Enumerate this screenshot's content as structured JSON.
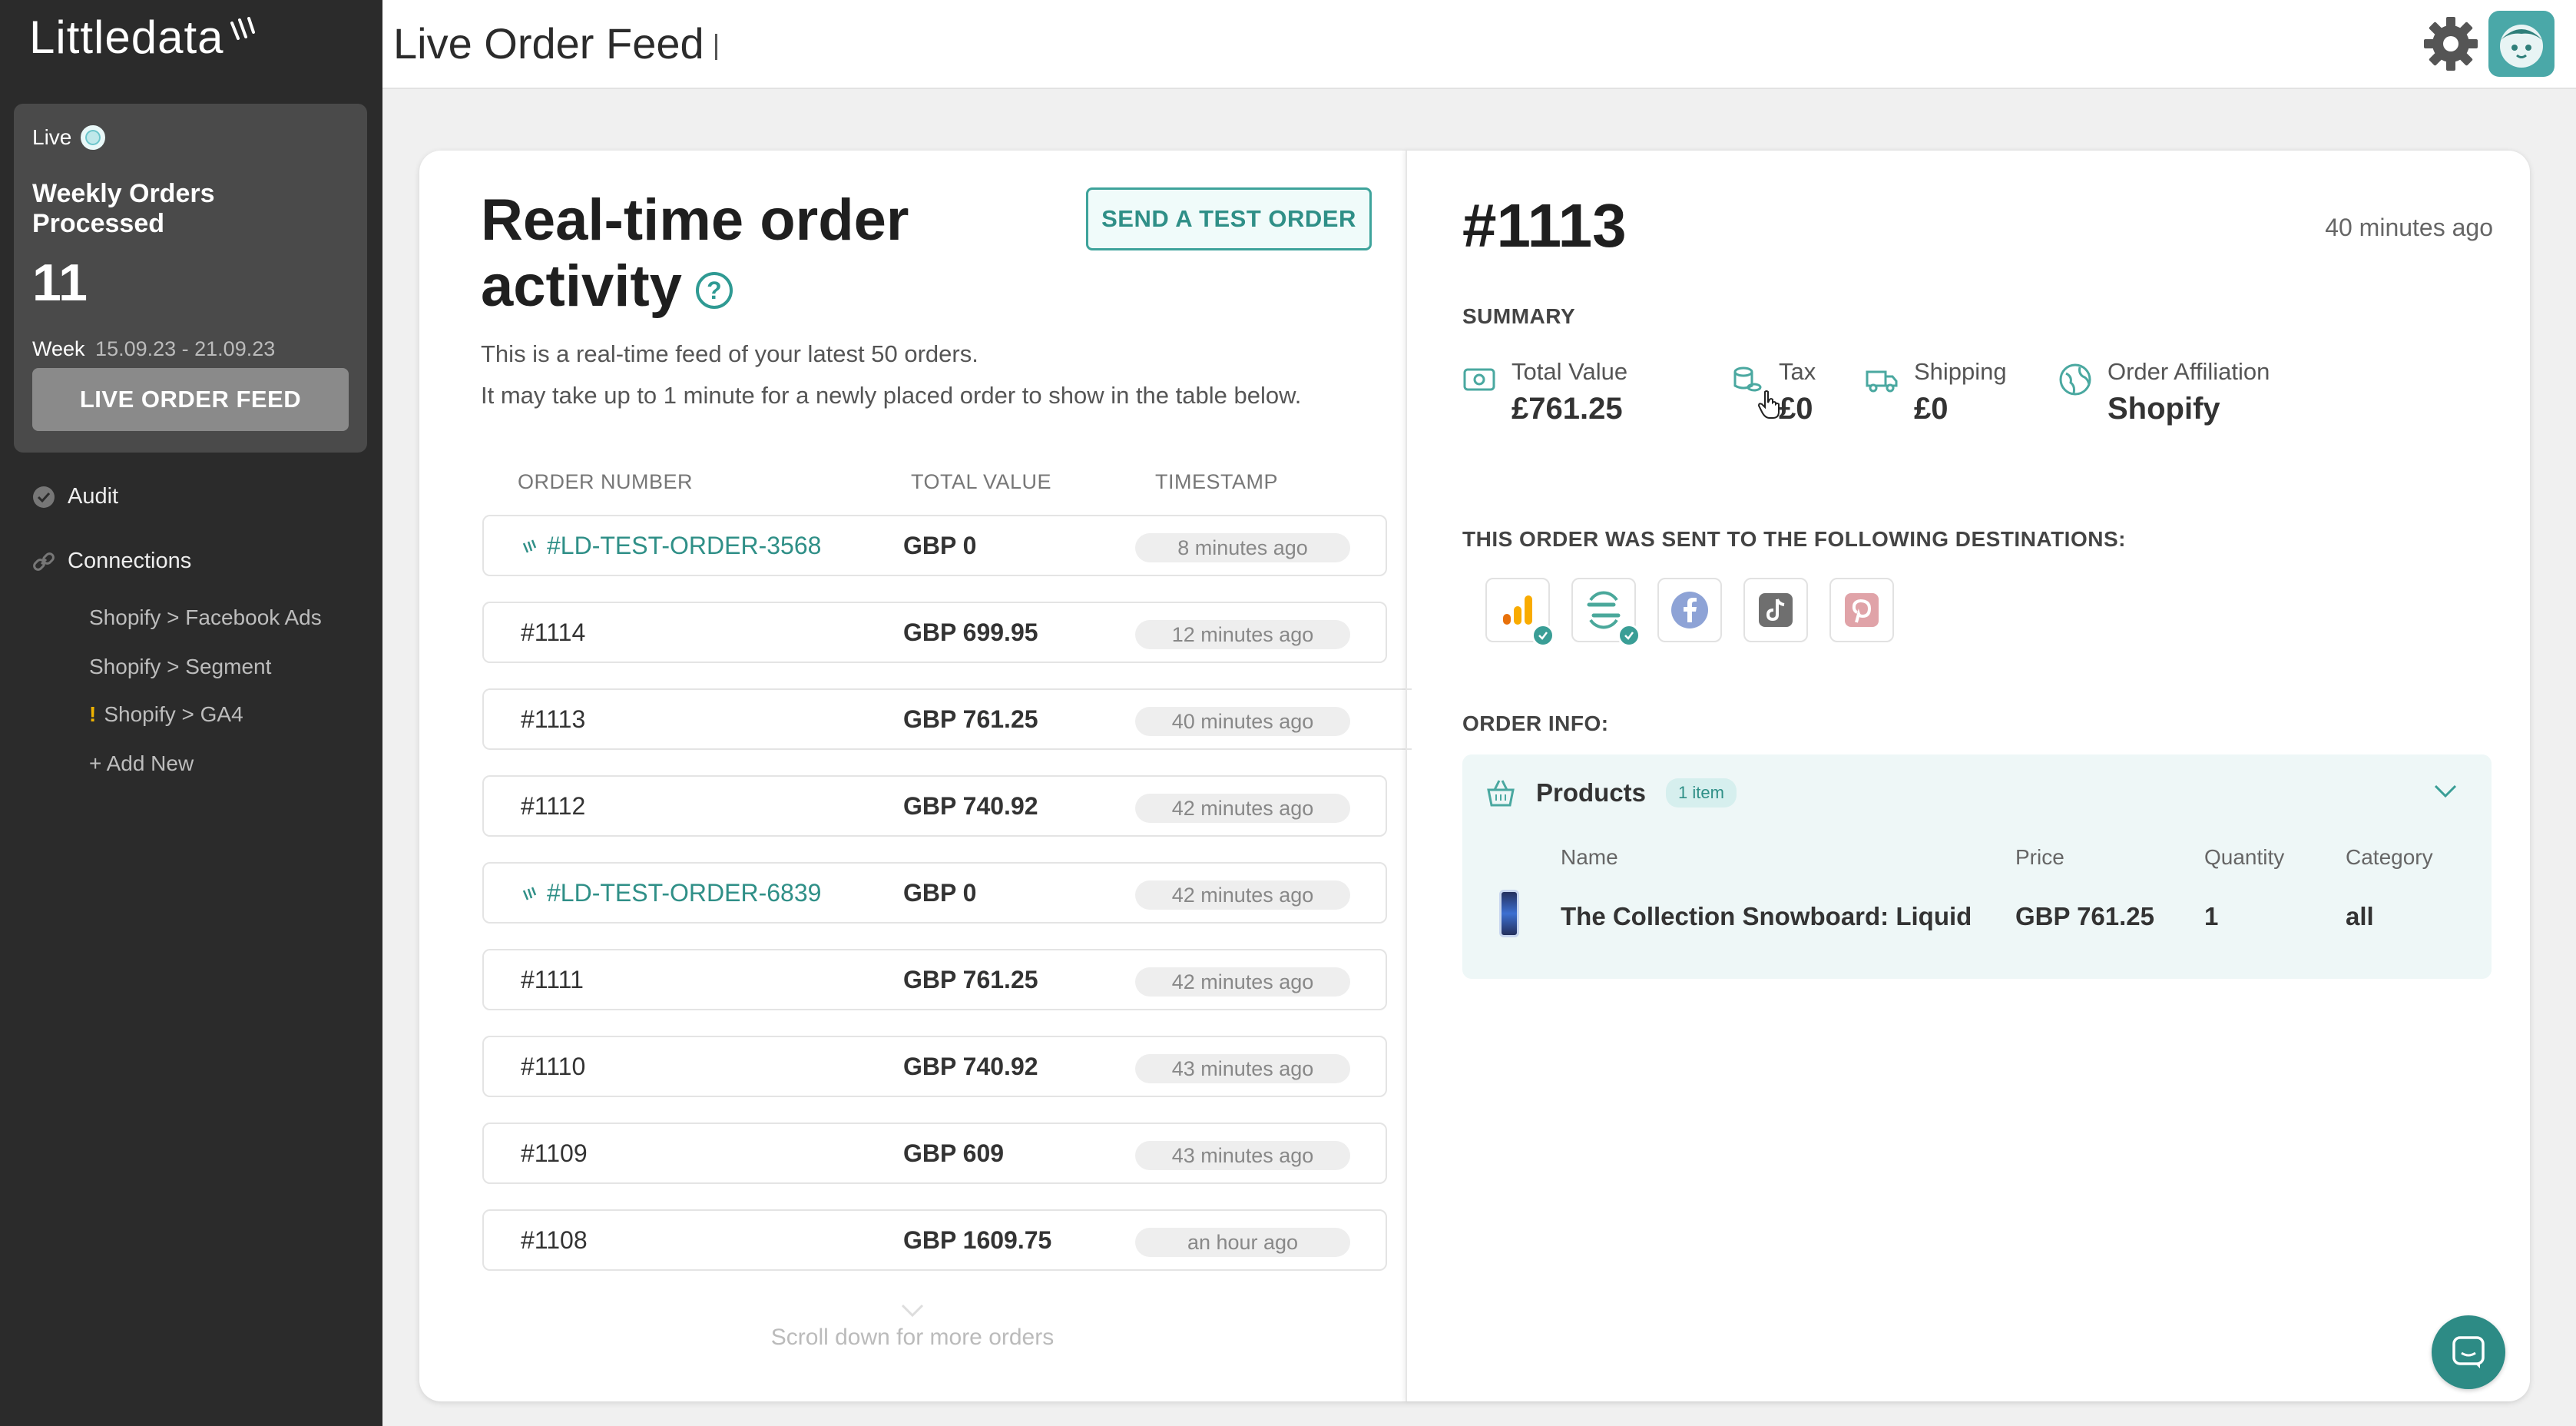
{
  "sidebar": {
    "logo_text": "Littledata",
    "live_label": "Live",
    "weekly_title": "Weekly Orders Processed",
    "weekly_count": "11",
    "week_label": "Week",
    "week_dates": "15.09.23 - 21.09.23",
    "live_feed_button": "LIVE ORDER FEED",
    "nav": [
      {
        "label": "Audit",
        "icon": "check-circle-icon"
      },
      {
        "label": "Connections",
        "icon": "link-icon"
      }
    ],
    "connections": [
      {
        "label": "Shopify > Facebook Ads",
        "warning": ""
      },
      {
        "label": "Shopify > Segment",
        "warning": ""
      },
      {
        "label": "Shopify > GA4",
        "warning": "!"
      },
      {
        "label": "+ Add New",
        "warning": ""
      }
    ]
  },
  "header": {
    "title": "Live Order Feed",
    "icons": [
      "gear-icon",
      "avatar-icon"
    ]
  },
  "feed": {
    "title_line1": "Real-time order",
    "title_line2": "activity",
    "help_glyph": "?",
    "test_button": "SEND A TEST ORDER",
    "desc_line1": "This is a real-time feed of your latest 50 orders.",
    "desc_line2": "It may take up to 1 minute for a newly placed order to show in the table below.",
    "columns": [
      "ORDER NUMBER",
      "TOTAL VALUE",
      "TIMESTAMP"
    ],
    "orders": [
      {
        "number": "#LD-TEST-ORDER-3568",
        "value": "GBP 0",
        "timestamp": "8 minutes ago",
        "test": true
      },
      {
        "number": "#1114",
        "value": "GBP 699.95",
        "timestamp": "12 minutes ago",
        "test": false
      },
      {
        "number": "#1113",
        "value": "GBP 761.25",
        "timestamp": "40 minutes ago",
        "test": false
      },
      {
        "number": "#1112",
        "value": "GBP 740.92",
        "timestamp": "42 minutes ago",
        "test": false
      },
      {
        "number": "#LD-TEST-ORDER-6839",
        "value": "GBP 0",
        "timestamp": "42 minutes ago",
        "test": true
      },
      {
        "number": "#1111",
        "value": "GBP 761.25",
        "timestamp": "42 minutes ago",
        "test": false
      },
      {
        "number": "#1110",
        "value": "GBP 740.92",
        "timestamp": "43 minutes ago",
        "test": false
      },
      {
        "number": "#1109",
        "value": "GBP 609",
        "timestamp": "43 minutes ago",
        "test": false
      },
      {
        "number": "#1108",
        "value": "GBP 1609.75",
        "timestamp": "an hour ago",
        "test": false
      }
    ],
    "scroll_hint": "Scroll down for more orders"
  },
  "detail": {
    "order_id": "#1113",
    "time": "40 minutes ago",
    "summary_label": "SUMMARY",
    "summary": [
      {
        "label": "Total Value",
        "value": "£761.25",
        "icon": "money-icon"
      },
      {
        "label": "Tax",
        "value": "£0",
        "icon": "coins-icon"
      },
      {
        "label": "Shipping",
        "value": "£0",
        "icon": "truck-icon"
      },
      {
        "label": "Order Affiliation",
        "value": "Shopify",
        "icon": "globe-icon"
      }
    ],
    "destinations_label": "THIS ORDER WAS SENT TO THE FOLLOWING DESTINATIONS:",
    "destinations": [
      {
        "name": "google-analytics-icon",
        "sent": true
      },
      {
        "name": "segment-icon",
        "sent": true
      },
      {
        "name": "facebook-icon",
        "sent": false
      },
      {
        "name": "tiktok-icon",
        "sent": false
      },
      {
        "name": "pinterest-icon",
        "sent": false
      }
    ],
    "order_info_label": "ORDER INFO:",
    "products_title": "Products",
    "products_badge": "1 item",
    "product_columns": [
      "Name",
      "Price",
      "Quantity",
      "Category"
    ],
    "products": [
      {
        "name": "The Collection Snowboard: Liquid",
        "price": "GBP 761.25",
        "quantity": "1",
        "category": "all"
      }
    ]
  },
  "colors": {
    "accent": "#2f8f87",
    "sidebar": "#2b2b2b",
    "card": "#4a4a4a"
  }
}
